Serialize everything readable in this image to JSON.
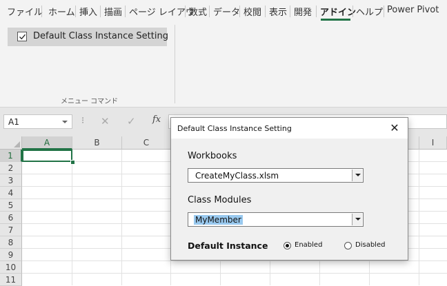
{
  "ribbon": {
    "tabs": [
      {
        "label": "ファイル"
      },
      {
        "label": "ホーム"
      },
      {
        "label": "挿入"
      },
      {
        "label": "描画"
      },
      {
        "label": "ページ レイアウ"
      },
      {
        "label": "数式"
      },
      {
        "label": "データ"
      },
      {
        "label": "校閲"
      },
      {
        "label": "表示"
      },
      {
        "label": "開発"
      },
      {
        "label": "アドイン",
        "active": true
      },
      {
        "label": "ヘルプ"
      },
      {
        "label": "Power Pivot"
      }
    ],
    "active_tab": "アドイン",
    "button": {
      "label": "Default Class Instance Setting",
      "checked": true
    },
    "group_label": "メニュー コマンド"
  },
  "formula_bar": {
    "name_box": "A1",
    "separator": "⁝",
    "cancel_icon": "✕",
    "enter_icon": "✓",
    "fx": "fx"
  },
  "sheet": {
    "columns": [
      "A",
      "B",
      "C",
      "I"
    ],
    "rows": [
      "1",
      "2",
      "3",
      "4",
      "5",
      "6",
      "7",
      "8",
      "9",
      "10",
      "11"
    ],
    "selected_cell": "A1"
  },
  "dialog": {
    "title": "Default Class Instance Setting",
    "close_icon": "✕",
    "workbooks_label": "Workbooks",
    "workbook_value": "CreateMyClass.xlsm",
    "class_modules_label": "Class Modules",
    "class_module_value": "MyMember",
    "default_instance_label": "Default Instance",
    "options": [
      {
        "label": "Enabled",
        "selected": true
      },
      {
        "label": "Disabled",
        "selected": false
      }
    ]
  },
  "colors": {
    "accent": "#217346",
    "ribbon_bg": "#f3f3f3",
    "selection_highlight": "#99c9ef"
  }
}
